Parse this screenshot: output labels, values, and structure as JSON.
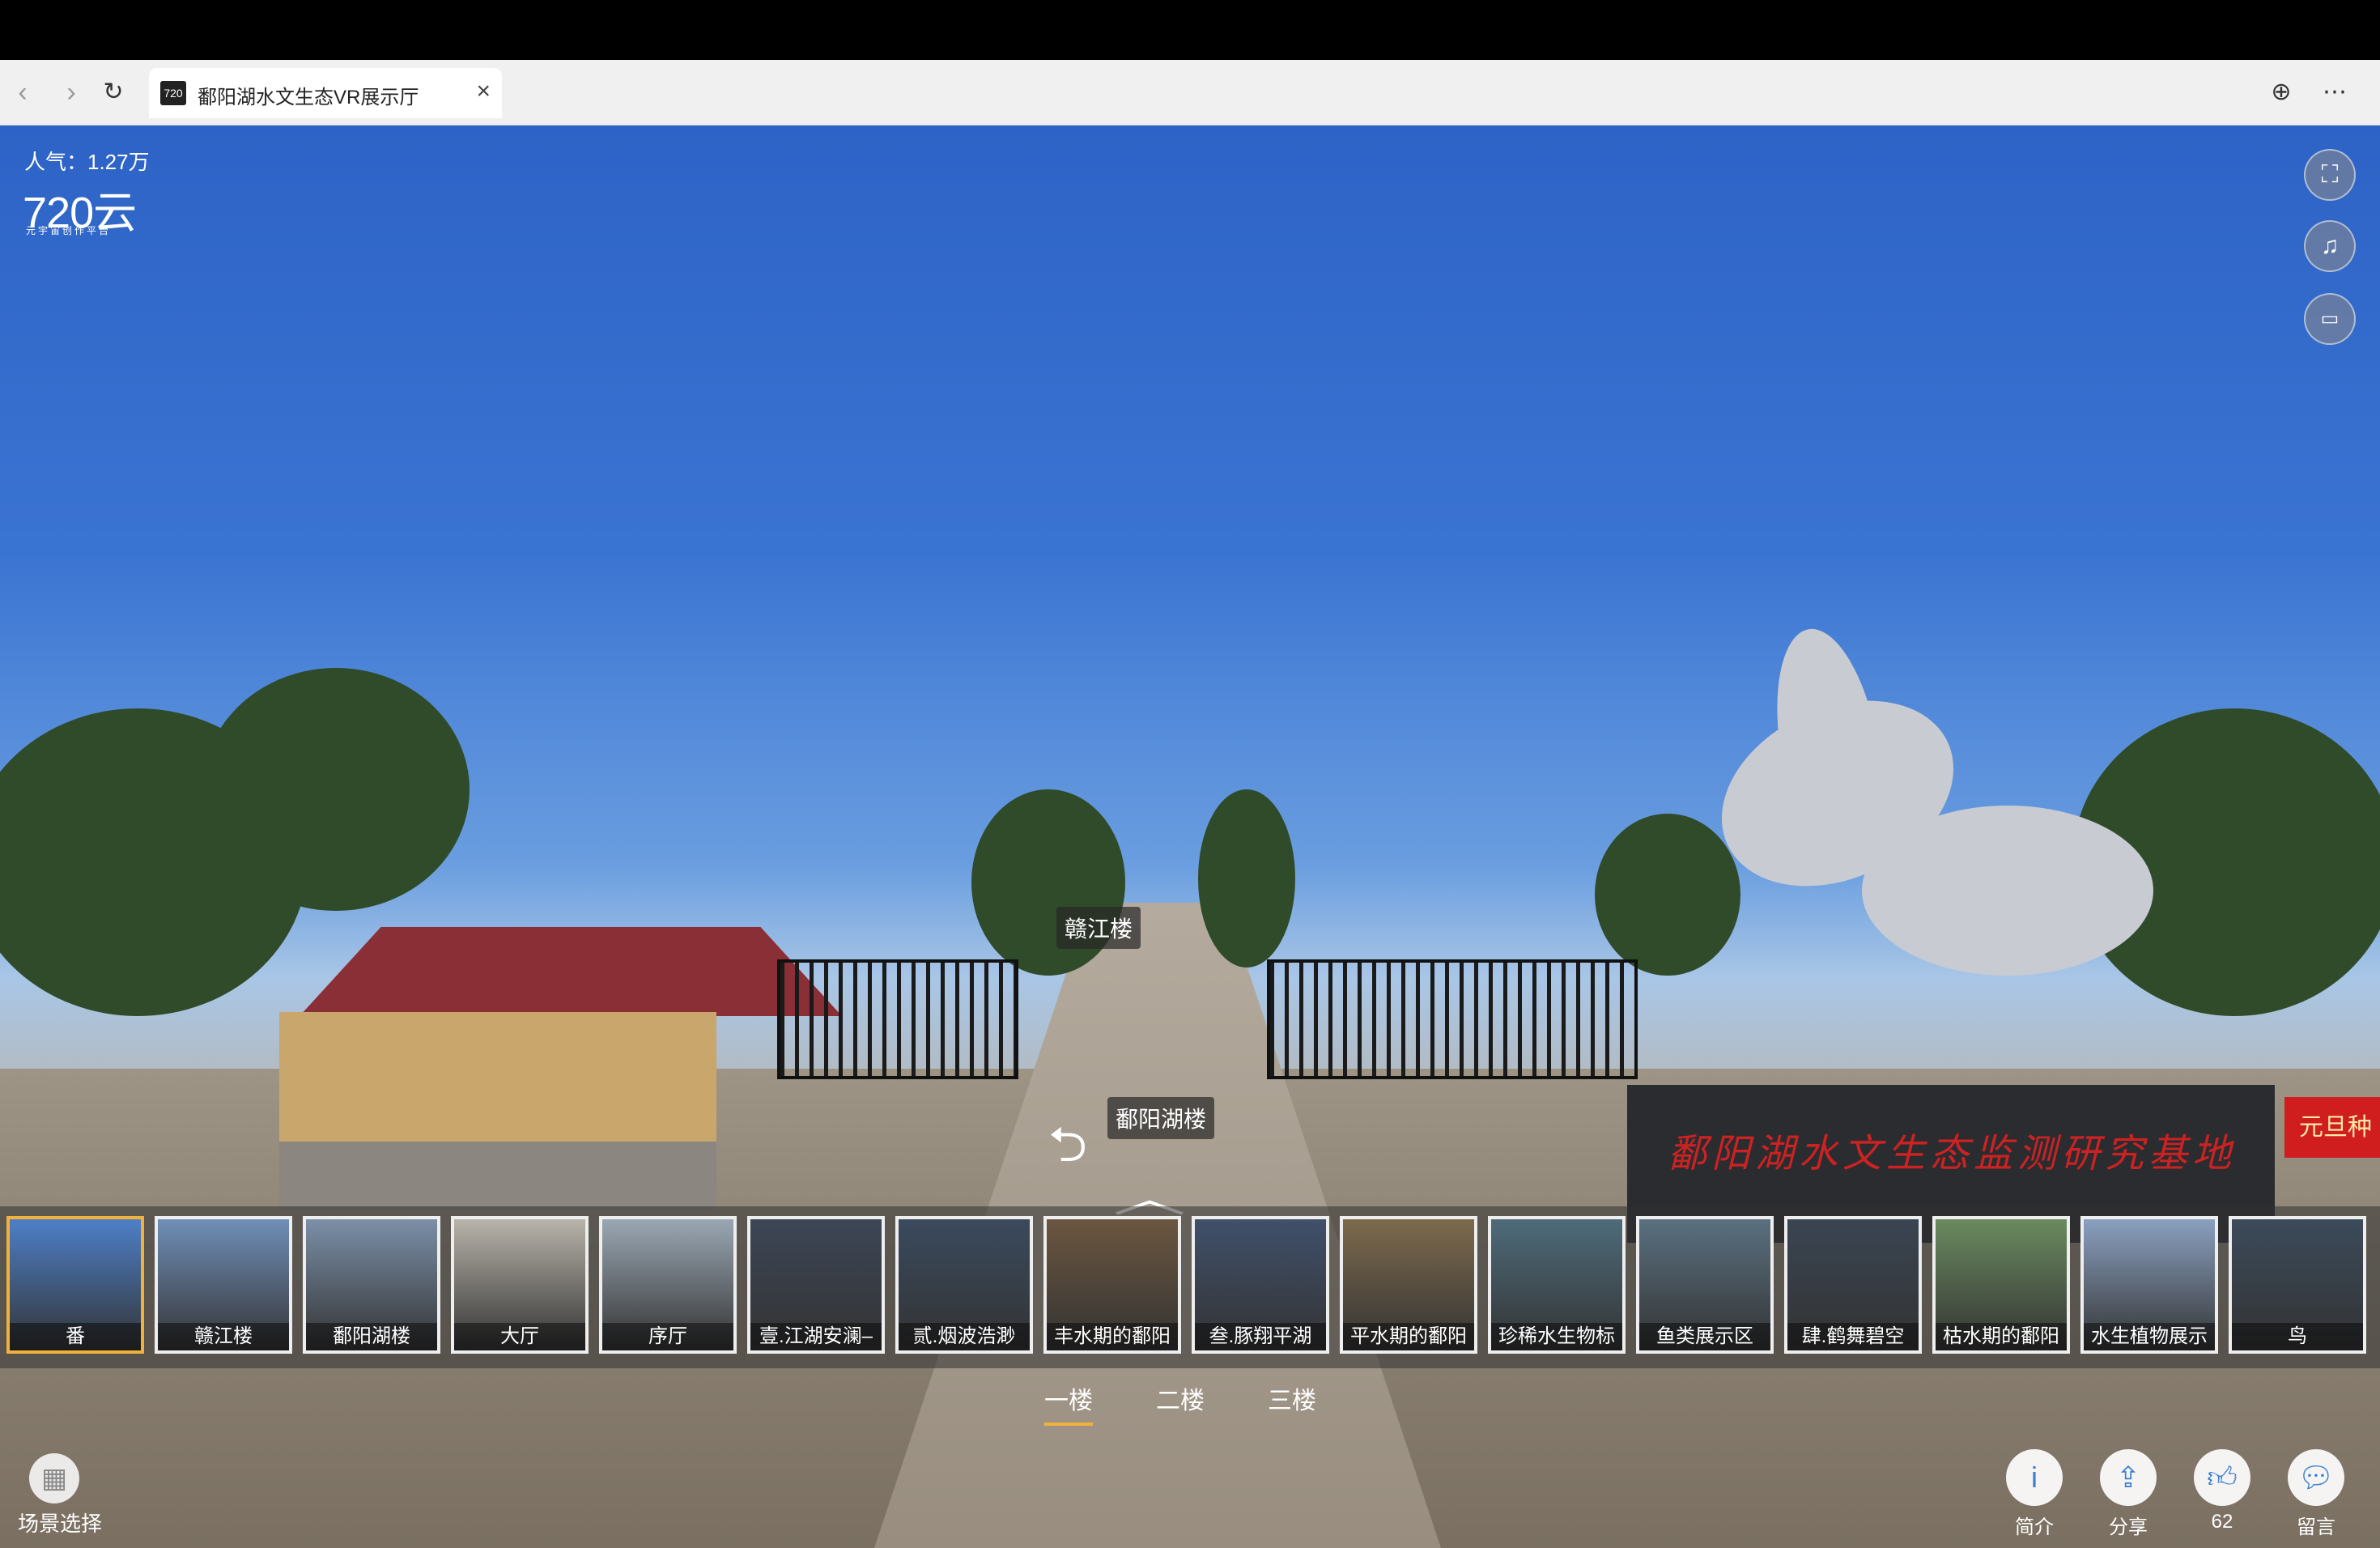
{
  "browser": {
    "tab_title": "鄱阳湖水文生态VR展示厅",
    "favicon_text": "720"
  },
  "overlay": {
    "popularity": "人气：1.27万",
    "logo": "720云",
    "logo_sub": "元宇宙创作平台"
  },
  "hotspots": {
    "ganjiang": "赣江楼",
    "poyang": "鄱阳湖楼"
  },
  "panorama": {
    "banner_text": "元旦种"
  },
  "scenes": [
    {
      "label": "番",
      "color": "#4d7fc8"
    },
    {
      "label": "赣江楼",
      "color": "#6f8fb8"
    },
    {
      "label": "鄱阳湖楼",
      "color": "#7b8fa7"
    },
    {
      "label": "大厅",
      "color": "#b8b3aa"
    },
    {
      "label": "序厅",
      "color": "#9aa7b3"
    },
    {
      "label": "壹.江湖安澜–",
      "color": "#3d4656"
    },
    {
      "label": "贰.烟波浩渺",
      "color": "#3a4a5d"
    },
    {
      "label": "丰水期的鄱阳",
      "color": "#6b5640"
    },
    {
      "label": "叁.豚翔平湖",
      "color": "#40506a"
    },
    {
      "label": "平水期的鄱阳",
      "color": "#7d6a4d"
    },
    {
      "label": "珍稀水生物标",
      "color": "#4e6b7a"
    },
    {
      "label": "鱼类展示区",
      "color": "#5a7080"
    },
    {
      "label": "肆.鹤舞碧空",
      "color": "#3a4552"
    },
    {
      "label": "枯水期的鄱阳",
      "color": "#6a8a5e"
    },
    {
      "label": "水生植物展示",
      "color": "#8aa0c0"
    },
    {
      "label": "鸟",
      "color": "#3b4a5a"
    }
  ],
  "floors": [
    "一楼",
    "二楼",
    "三楼"
  ],
  "bottom": {
    "scene_select": "场景选择",
    "intro": "简介",
    "share": "分享",
    "likes": "62",
    "comment": "留言"
  }
}
